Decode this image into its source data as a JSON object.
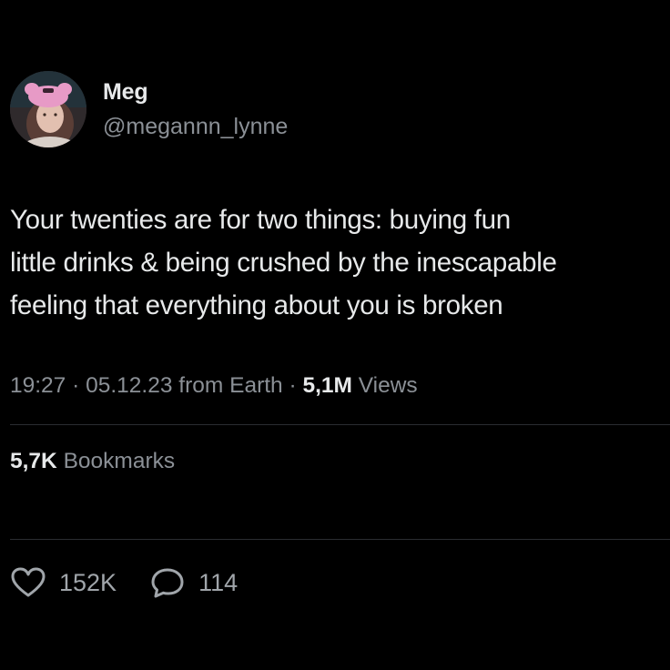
{
  "author": {
    "display_name": "Meg",
    "handle": "@megannn_lynne",
    "avatar_icon": "profile-avatar"
  },
  "tweet": {
    "lines": [
      "Your twenties are for two things: buying fun",
      "little drinks & being crushed by the inescapable",
      "feeling that everything about you is broken"
    ]
  },
  "meta": {
    "time": "19:27",
    "separator": "·",
    "date": "05.12.23",
    "source": "from Earth",
    "views_count": "5,1M",
    "views_label": "Views"
  },
  "bookmarks": {
    "count": "5,7K",
    "label": "Bookmarks"
  },
  "actions": {
    "likes_icon": "heart-icon",
    "likes_count": "152K",
    "replies_icon": "reply-bubble-icon",
    "replies_count": "114"
  },
  "colors": {
    "background": "#000000",
    "primary_text": "#e7e9ea",
    "secondary_text": "#8b9096",
    "divider": "#2a2d31"
  }
}
